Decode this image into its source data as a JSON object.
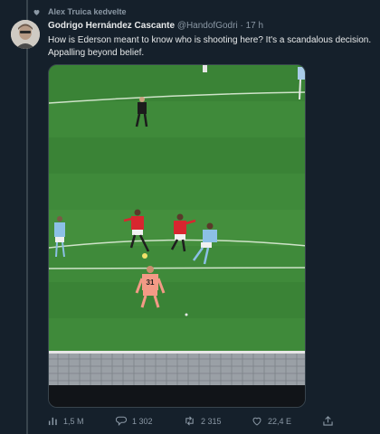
{
  "context": {
    "liked_by": "Alex Truica kedvelte"
  },
  "tweet": {
    "author_name": "Godrigo Hernández Cascante",
    "handle": "@HandofGodri",
    "separator": "·",
    "time": "17 h",
    "text_line1": "How is Ederson meant to know who is shooting here? It's a scandalous decision.",
    "text_line2": "Appalling beyond belief.",
    "player_number": "31"
  },
  "actions": {
    "views": "1,5 M",
    "replies": "1 302",
    "retweets": "2 315",
    "likes": "22,4 E"
  },
  "icons": [
    "heart-icon",
    "views-icon",
    "reply-icon",
    "retweet-icon",
    "like-icon",
    "share-icon"
  ],
  "colors": {
    "background": "#15202b",
    "text": "#e7e9ea",
    "muted": "#8b98a5",
    "pitch": "#3f8a3a"
  }
}
